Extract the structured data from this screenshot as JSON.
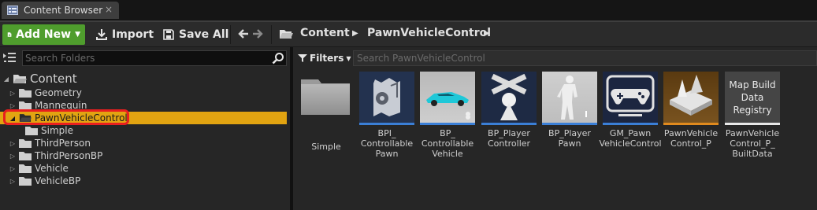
{
  "tab": {
    "title": "Content Browser",
    "close": "×"
  },
  "toolbar": {
    "add_new": "Add New",
    "import": "Import",
    "save_all": "Save All",
    "breadcrumb": [
      "Content",
      "PawnVehicleControl"
    ]
  },
  "sources": {
    "search_placeholder": "Search Folders",
    "root": "Content",
    "folders": [
      {
        "label": "Geometry",
        "expanded": false
      },
      {
        "label": "Mannequin",
        "expanded": false
      },
      {
        "label": "PawnVehicleControl",
        "expanded": true,
        "selected": true
      },
      {
        "label": "Simple",
        "child": true
      },
      {
        "label": "ThirdPerson",
        "expanded": false
      },
      {
        "label": "ThirdPersonBP",
        "expanded": false
      },
      {
        "label": "Vehicle",
        "expanded": false
      },
      {
        "label": "VehicleBP",
        "expanded": false
      }
    ]
  },
  "assets": {
    "filters_label": "Filters",
    "search_placeholder": "Search PawnVehicleControl",
    "items": [
      {
        "label": "Simple",
        "kind": "folder"
      },
      {
        "label": "BPI_\nControllable\nPawn",
        "kind": "blueprint-interface",
        "bar_color": "#3b7fd6"
      },
      {
        "label": "BP_\nControllable\nVehicle",
        "kind": "blueprint",
        "bar_color": "#3b7fd6"
      },
      {
        "label": "BP_Player\nController",
        "kind": "blueprint",
        "bar_color": "#3b7fd6"
      },
      {
        "label": "BP_Player\nPawn",
        "kind": "blueprint",
        "bar_color": "#3b7fd6"
      },
      {
        "label": "GM_Pawn\nVehicleControl",
        "kind": "blueprint",
        "bar_color": "#3b7fd6"
      },
      {
        "label": "PawnVehicle\nControl_P",
        "kind": "level",
        "bar_color": "#e08a1e"
      },
      {
        "label": "PawnVehicle\nControl_P_\nBuiltData",
        "kind": "map-build-data",
        "thumb_text": "Map Build\nData\nRegistry",
        "bar_color": "#e8e8e8"
      }
    ]
  },
  "colors": {
    "add_new": "#4f9d2d",
    "selection": "#e2a411",
    "highlight_outline": "#e81f1f"
  }
}
